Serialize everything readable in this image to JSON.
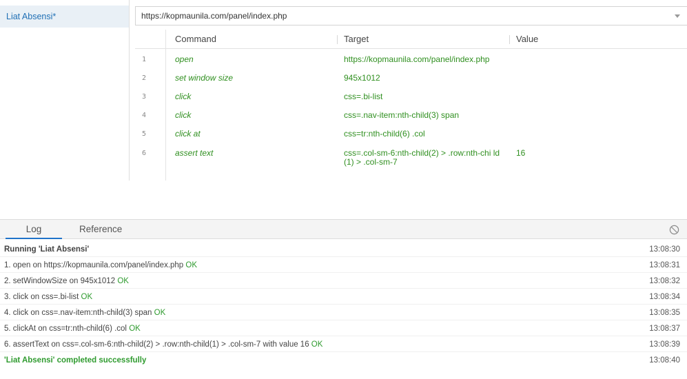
{
  "test_list": {
    "selected_test": "Liat Absensi*"
  },
  "url_bar": {
    "value": "https://kopmaunila.com/panel/index.php"
  },
  "commands_table": {
    "headers": {
      "command": "Command",
      "target": "Target",
      "value": "Value"
    },
    "rows": [
      {
        "num": "1",
        "command": "open",
        "target": "https://kopmaunila.com/panel/index.php",
        "value": ""
      },
      {
        "num": "2",
        "command": "set window size",
        "target": "945x1012",
        "value": ""
      },
      {
        "num": "3",
        "command": "click",
        "target": "css=.bi-list",
        "value": ""
      },
      {
        "num": "4",
        "command": "click",
        "target": "css=.nav-item:nth-child(3) span",
        "value": ""
      },
      {
        "num": "5",
        "command": "click at",
        "target": "css=tr:nth-child(6) .col",
        "value": ""
      },
      {
        "num": "6",
        "command": "assert text",
        "target": "css=.col-sm-6:nth-child(2) > .row:nth-chi ld(1) > .col-sm-7",
        "value": "16"
      }
    ]
  },
  "log_panel": {
    "tabs": {
      "log": "Log",
      "reference": "Reference"
    },
    "clear_icon": "circle-slash-icon",
    "entries": [
      {
        "text": "Running 'Liat Absensi'",
        "ok": "",
        "time": "13:08:30"
      },
      {
        "text": "1.  open on https://kopmaunila.com/panel/index.php",
        "ok": "OK",
        "time": "13:08:31"
      },
      {
        "text": "2.  setWindowSize on 945x1012",
        "ok": "OK",
        "time": "13:08:32"
      },
      {
        "text": "3.  click on css=.bi-list",
        "ok": "OK",
        "time": "13:08:34"
      },
      {
        "text": "4.  click on css=.nav-item:nth-child(3) span",
        "ok": "OK",
        "time": "13:08:35"
      },
      {
        "text": "5.  clickAt on css=tr:nth-child(6) .col",
        "ok": "OK",
        "time": "13:08:37"
      },
      {
        "text": "6.  assertText on css=.col-sm-6:nth-child(2) > .row:nth-child(1) > .col-sm-7 with value 16",
        "ok": "OK",
        "time": "13:08:39"
      },
      {
        "text": "'Liat Absensi' completed successfully",
        "ok": "",
        "time": "13:08:40"
      }
    ]
  },
  "colors": {
    "accent_blue": "#1f73c9",
    "command_green": "#2f8f1f",
    "ok_green": "#2f9b2f",
    "selected_row_bg": "#e9f0f6"
  }
}
